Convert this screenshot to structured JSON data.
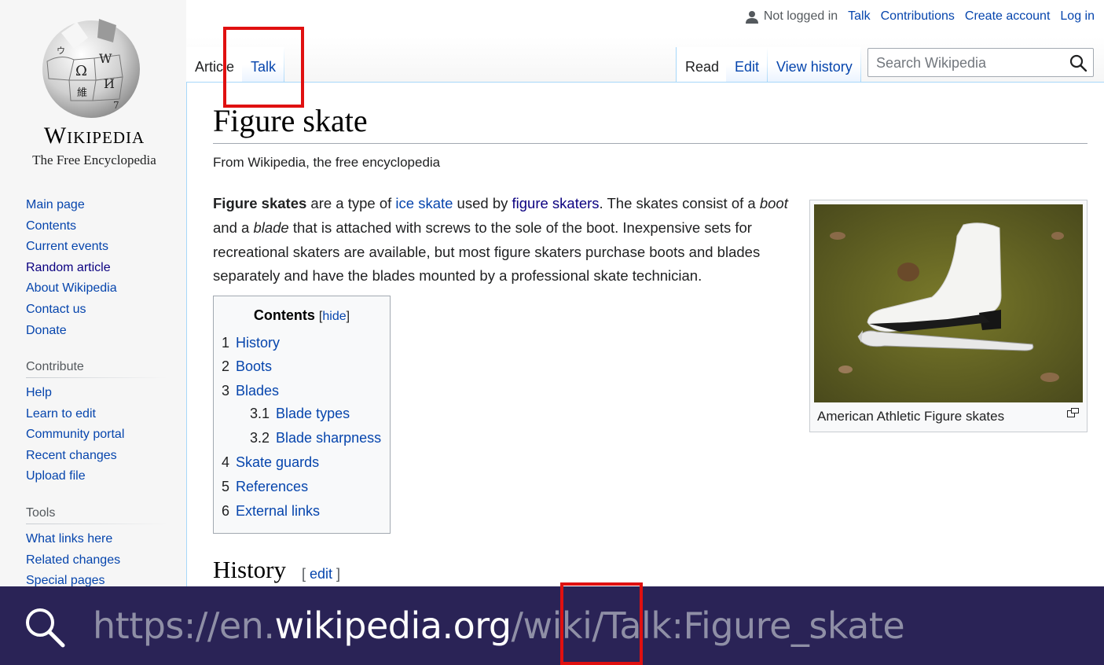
{
  "logo": {
    "wordmark": "Wikipedia",
    "tagline": "The Free Encyclopedia"
  },
  "sidebar": {
    "main": [
      {
        "label": "Main page"
      },
      {
        "label": "Contents"
      },
      {
        "label": "Current events"
      },
      {
        "label": "Random article"
      },
      {
        "label": "About Wikipedia"
      },
      {
        "label": "Contact us"
      },
      {
        "label": "Donate"
      }
    ],
    "contribute_heading": "Contribute",
    "contribute": [
      {
        "label": "Help"
      },
      {
        "label": "Learn to edit"
      },
      {
        "label": "Community portal"
      },
      {
        "label": "Recent changes"
      },
      {
        "label": "Upload file"
      }
    ],
    "tools_heading": "Tools",
    "tools": [
      {
        "label": "What links here"
      },
      {
        "label": "Related changes"
      },
      {
        "label": "Special pages"
      }
    ]
  },
  "user": {
    "not_logged_in": "Not logged in",
    "talk": "Talk",
    "contributions": "Contributions",
    "create_account": "Create account",
    "log_in": "Log in"
  },
  "tabs": {
    "article": "Article",
    "talk": "Talk",
    "read": "Read",
    "edit": "Edit",
    "view_history": "View history"
  },
  "search": {
    "placeholder": "Search Wikipedia"
  },
  "article": {
    "title": "Figure skate",
    "site_sub": "From Wikipedia, the free encyclopedia",
    "intro": {
      "bold": "Figure skates",
      "t1": " are a type of ",
      "link1": "ice skate",
      "t2": " used by ",
      "link2": "figure skaters",
      "t3": ". The skates consist of a ",
      "i1": "boot",
      "t4": " and a ",
      "i2": "blade",
      "t5": " that is attached with screws to the sole of the boot. Inexpensive sets for recreational skaters are available, but most figure skaters purchase boots and blades separately and have the blades mounted by a professional skate technician."
    },
    "toc": {
      "title": "Contents",
      "hide": "hide",
      "items": [
        {
          "num": "1",
          "label": "History"
        },
        {
          "num": "2",
          "label": "Boots"
        },
        {
          "num": "3",
          "label": "Blades"
        },
        {
          "num": "3.1",
          "label": "Blade types"
        },
        {
          "num": "3.2",
          "label": "Blade sharpness"
        },
        {
          "num": "4",
          "label": "Skate guards"
        },
        {
          "num": "5",
          "label": "References"
        },
        {
          "num": "6",
          "label": "External links"
        }
      ]
    },
    "thumb_caption": "American Athletic Figure skates",
    "section_heading": "History",
    "section_edit": "edit"
  },
  "urlbar": {
    "prefix": "https://en.",
    "domain": "wikipedia.org",
    "path": "/wiki/Talk:Figure_skate"
  },
  "colors": {
    "link": "#0645ad",
    "visited": "#0b0080",
    "highlight": "#e01010",
    "urlbar_bg": "#2a2356"
  }
}
